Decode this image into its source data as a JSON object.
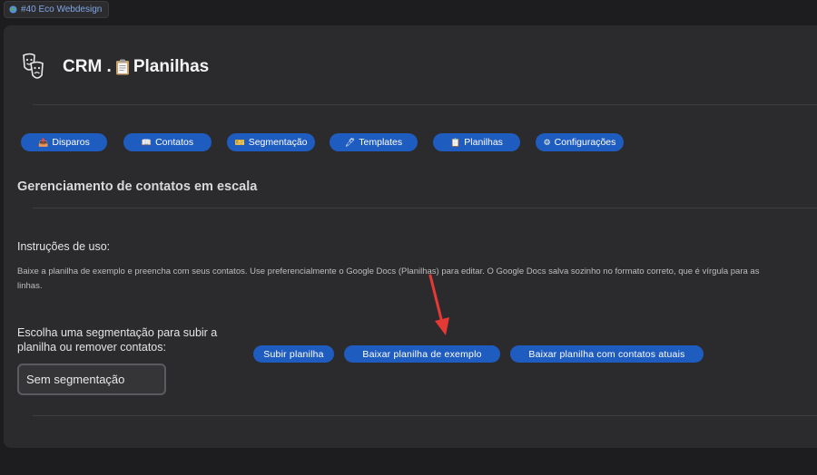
{
  "browser_tab": {
    "label": "#40 Eco Webdesign",
    "icon": "globe-icon"
  },
  "header": {
    "title_prefix": "CRM .",
    "title_suffix": "Planilhas",
    "logo_icon": "faces-logo-icon",
    "title_icon": "clipboard-icon"
  },
  "nav": [
    {
      "icon": "📤",
      "label": "Disparos"
    },
    {
      "icon": "📖",
      "label": "Contatos"
    },
    {
      "icon": "🎫",
      "label": "Segmentação"
    },
    {
      "icon": "🖊",
      "label": "Templates"
    },
    {
      "icon": "📋",
      "label": "Planilhas"
    },
    {
      "icon": "⚙",
      "label": "Configurações"
    }
  ],
  "section": {
    "title": "Gerenciamento de contatos em escala"
  },
  "instructions": {
    "title": "Instruções de uso:",
    "line1": "Baixe a planilha de exemplo e preencha com seus contatos. Use preferencialmente o Google Docs (Planilhas) para editar. O Google Docs salva sozinho no formato correto, que é vírgula para as",
    "line2": "linhas."
  },
  "segmentation": {
    "label": "Escolha uma segmentação para subir a planilha ou remover contatos:",
    "selected": "Sem segmentação"
  },
  "actions": {
    "upload": "Subir planilha",
    "download_example": "Baixar planilha de exemplo",
    "download_current": "Baixar planilha com contatos atuais"
  },
  "colors": {
    "accent": "#1f5cc0",
    "panel": "#2b2b2d",
    "background": "#1d1d1f",
    "annotation": "#e53935"
  }
}
